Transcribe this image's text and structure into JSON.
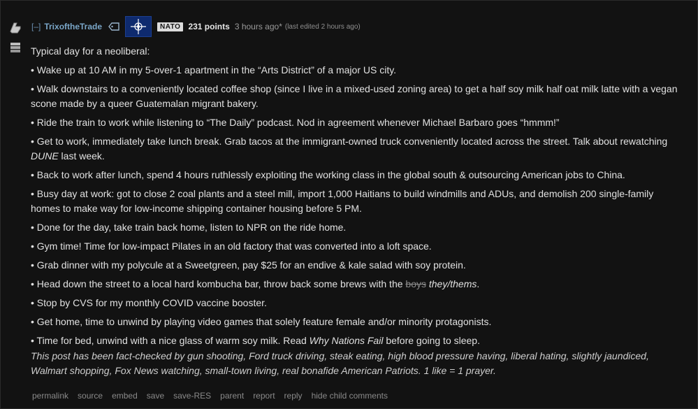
{
  "comment": {
    "collapse_label": "[–]",
    "author": "TrixoftheTrade",
    "flair": "NATO",
    "points": "231 points",
    "time": "3 hours ago*",
    "edited": "(last edited 2 hours ago)",
    "intro": "Typical day for a neoliberal:",
    "items": [
      "• Wake up at 10 AM in my 5-over-1 apartment in the “Arts District” of a major US city.",
      "• Walk downstairs to a conveniently located coffee shop (since I live in a mixed-used zoning area) to get a half soy milk half oat milk latte with a vegan scone made by a queer Guatemalan migrant bakery.",
      "• Ride the train to work while listening to “The Daily” podcast. Nod in agreement whenever Michael Barbaro goes “hmmm!”"
    ],
    "item4_a": "• Get to work, immediately take lunch break. Grab tacos at the immigrant-owned truck conveniently located across the street. Talk about rewatching ",
    "item4_it": "DUNE",
    "item4_b": " last week.",
    "items2": [
      "• Back to work after lunch, spend 4 hours ruthlessly exploiting the working class in the global south & outsourcing American jobs to China.",
      "• Busy day at work: got to close 2 coal plants and a steel mill, import 1,000 Haitians to build windmills and ADUs, and demolish 200 single-family homes to make way for low-income shipping container housing before 5 PM.",
      "• Done for the day, take train back home, listen to NPR on the ride home.",
      "• Gym time! Time for low-impact Pilates in an old factory that was converted into a loft space.",
      "• Grab dinner with my polycule at a Sweetgreen, pay $25 for an endive & kale salad with soy protein."
    ],
    "item10_a": "• Head down the street to a local hard kombucha bar, throw back some brews with the ",
    "item10_strike": "boys",
    "item10_it": "they/thems",
    "item10_b": ".",
    "items3": [
      "• Stop by CVS for my monthly COVID vaccine booster.",
      "• Get home, time to unwind by playing video games that solely feature female and/or minority protagonists."
    ],
    "item13_a": "• Time for bed, unwind with a nice glass of warm soy milk. Read ",
    "item13_it": "Why Nations Fail",
    "item13_b": " before going to sleep.",
    "factcheck": "This post has been fact-checked by gun shooting, Ford truck driving, steak eating, high blood pressure having, liberal hating, slightly jaundiced, Walmart shopping, Fox News watching, small-town living, real bonafide American Patriots. 1 like = 1 prayer."
  },
  "actions": {
    "permalink": "permalink",
    "source": "source",
    "embed": "embed",
    "save": "save",
    "save_res": "save-RES",
    "parent": "parent",
    "report": "report",
    "reply": "reply",
    "hide_children": "hide child comments"
  }
}
